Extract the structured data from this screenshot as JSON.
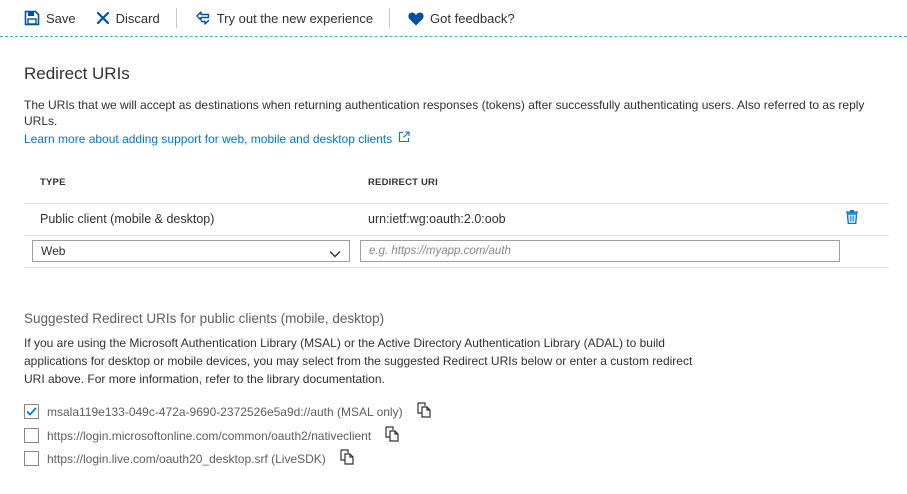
{
  "toolbar": {
    "save_label": "Save",
    "discard_label": "Discard",
    "try_label": "Try out the new experience",
    "feedback_label": "Got feedback?"
  },
  "section": {
    "title": "Redirect URIs",
    "description": "The URIs that we will accept as destinations when returning authentication responses (tokens) after successfully authenticating users. Also referred to as reply URLs.",
    "learn_more": "Learn more about adding support for web, mobile and desktop clients"
  },
  "table": {
    "headers": {
      "type": "TYPE",
      "redirect_uri": "REDIRECT URI"
    },
    "rows": [
      {
        "type": "Public client (mobile & desktop)",
        "uri": "urn:ietf:wg:oauth:2.0:oob"
      }
    ],
    "new_row": {
      "type_selected": "Web",
      "uri_placeholder": "e.g. https://myapp.com/auth"
    }
  },
  "suggested": {
    "title": "Suggested Redirect URIs for public clients (mobile, desktop)",
    "description": "If you are using the Microsoft Authentication Library (MSAL) or the Active Directory Authentication Library (ADAL) to build applications for desktop or mobile devices, you may select from the suggested Redirect URIs below or enter a custom redirect URI above. For more information, refer to the library documentation.",
    "items": [
      {
        "label": "msala119e133-049c-472a-9690-2372526e5a9d://auth (MSAL only)",
        "checked": true
      },
      {
        "label": "https://login.microsoftonline.com/common/oauth2/nativeclient",
        "checked": false
      },
      {
        "label": "https://login.live.com/oauth20_desktop.srf (LiveSDK)",
        "checked": false
      }
    ]
  },
  "colors": {
    "accent": "#0078d4",
    "brand_blue": "#0050a0",
    "divider": "#e1dfdd",
    "toolbar_border": "#3db3c2"
  },
  "icons": [
    "save-icon",
    "discard-icon",
    "try-new-icon",
    "heart-icon",
    "external-link-icon",
    "trash-icon",
    "chevron-down-icon",
    "check-icon",
    "copy-icon"
  ]
}
